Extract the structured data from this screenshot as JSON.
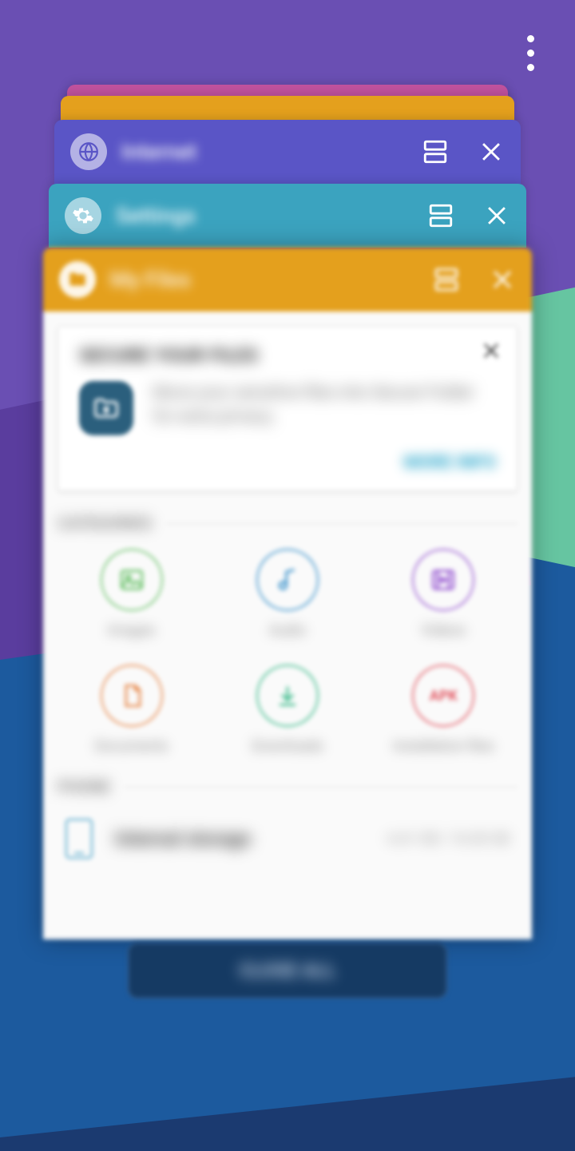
{
  "recents": {
    "menu_icon": "more-vert",
    "close_all_label": "CLOSE ALL",
    "cards": [
      {
        "color": "#c0529e"
      },
      {
        "color": "#e4a01d"
      },
      {
        "app": "Internet",
        "icon": "globe",
        "color": "#5a55c6"
      },
      {
        "app": "Settings",
        "icon": "gear",
        "color": "#3ba3bf"
      },
      {
        "app": "My Files",
        "icon": "folder",
        "color": "#e4a01d",
        "is_front": true
      }
    ]
  },
  "myfiles": {
    "promo": {
      "title": "SECURE YOUR FILES",
      "desc": "Move your sensitive files into Secure Folder for extra privacy.",
      "link": "MORE INFO",
      "icon": "secure-folder"
    },
    "sections": {
      "categories_label": "CATEGORIES",
      "phone_label": "PHONE"
    },
    "categories": [
      {
        "label": "Images",
        "icon": "image",
        "color": "#6cc36c"
      },
      {
        "label": "Audio",
        "icon": "music",
        "color": "#3b93cc"
      },
      {
        "label": "Videos",
        "icon": "video",
        "color": "#9a5cd3"
      },
      {
        "label": "Documents",
        "icon": "document",
        "color": "#e7894c"
      },
      {
        "label": "Downloads",
        "icon": "download",
        "color": "#3cbb8b"
      },
      {
        "label": "Installation files",
        "icon": "apk",
        "color": "#e25964"
      }
    ],
    "storage": {
      "name": "Internal storage",
      "size": "6.61 GB / 16.00 GB"
    }
  }
}
